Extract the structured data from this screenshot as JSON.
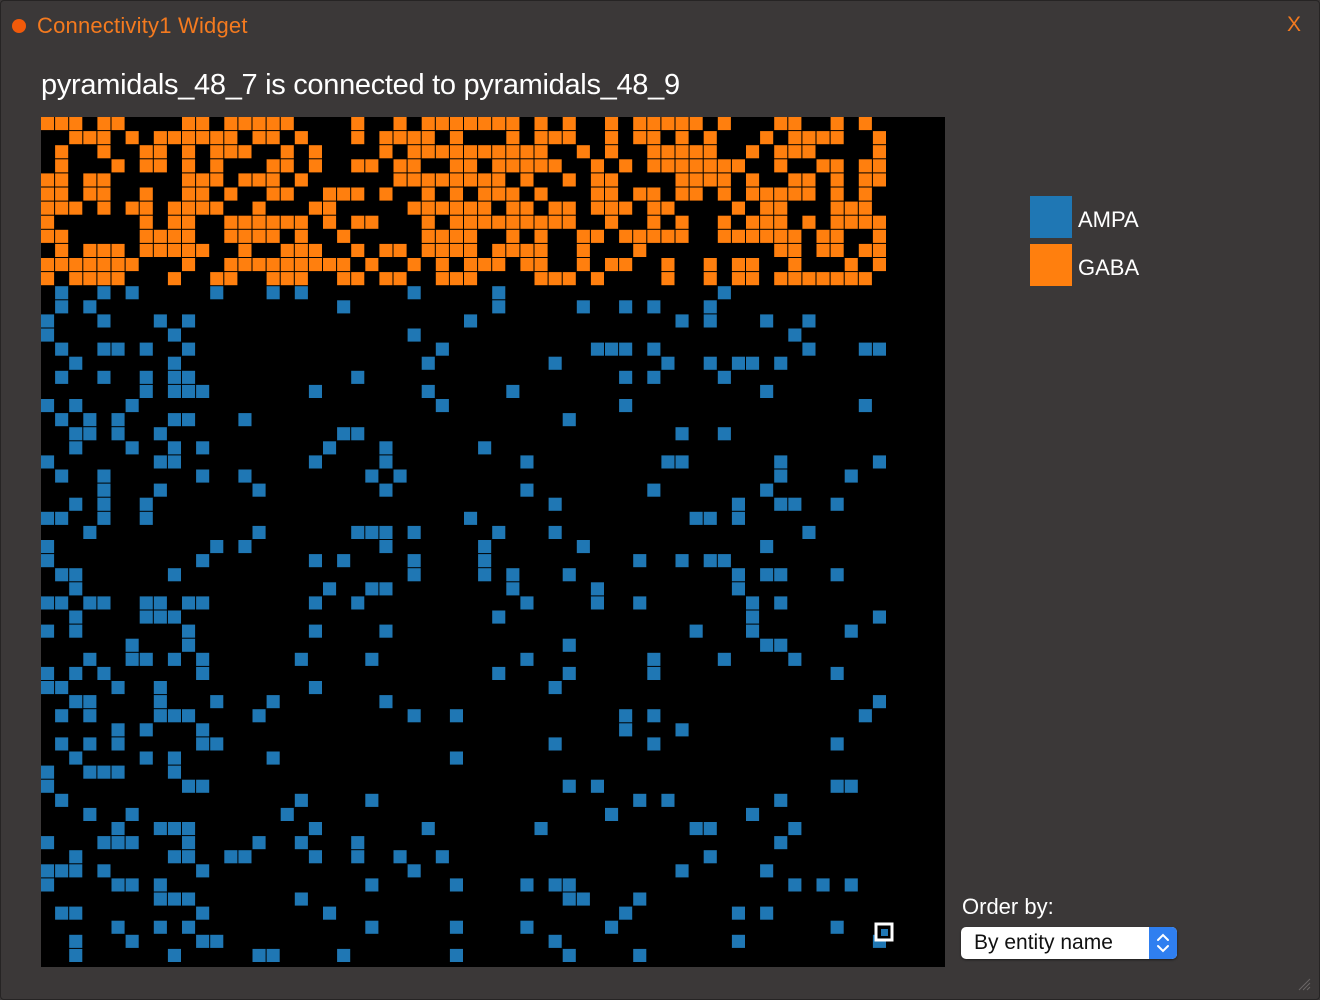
{
  "window": {
    "title": "Connectivity1 Widget",
    "close_label": "X",
    "title_color": "#f47a1f",
    "status_dot_color": "#f15a0a"
  },
  "heading": "pyramidals_48_7 is connected to pyramidals_48_9",
  "legend": {
    "items": [
      {
        "label": "AMPA",
        "color": "#1f77b4"
      },
      {
        "label": "GABA",
        "color": "#ff7f0e"
      }
    ]
  },
  "order": {
    "label": "Order by:",
    "selected": "By entity name"
  },
  "colors": {
    "background": "#3b3838",
    "matrix_background": "#000000",
    "ampa": "#1f77b4",
    "gaba": "#ff7f0e",
    "highlight_border": "#ffffff",
    "select_arrow_bg": "#2f7ff0"
  },
  "icons": {
    "status": "status-dot-icon",
    "close": "close-icon",
    "select": "chevron-up-down-icon",
    "resize": "resize-grip-icon"
  }
}
